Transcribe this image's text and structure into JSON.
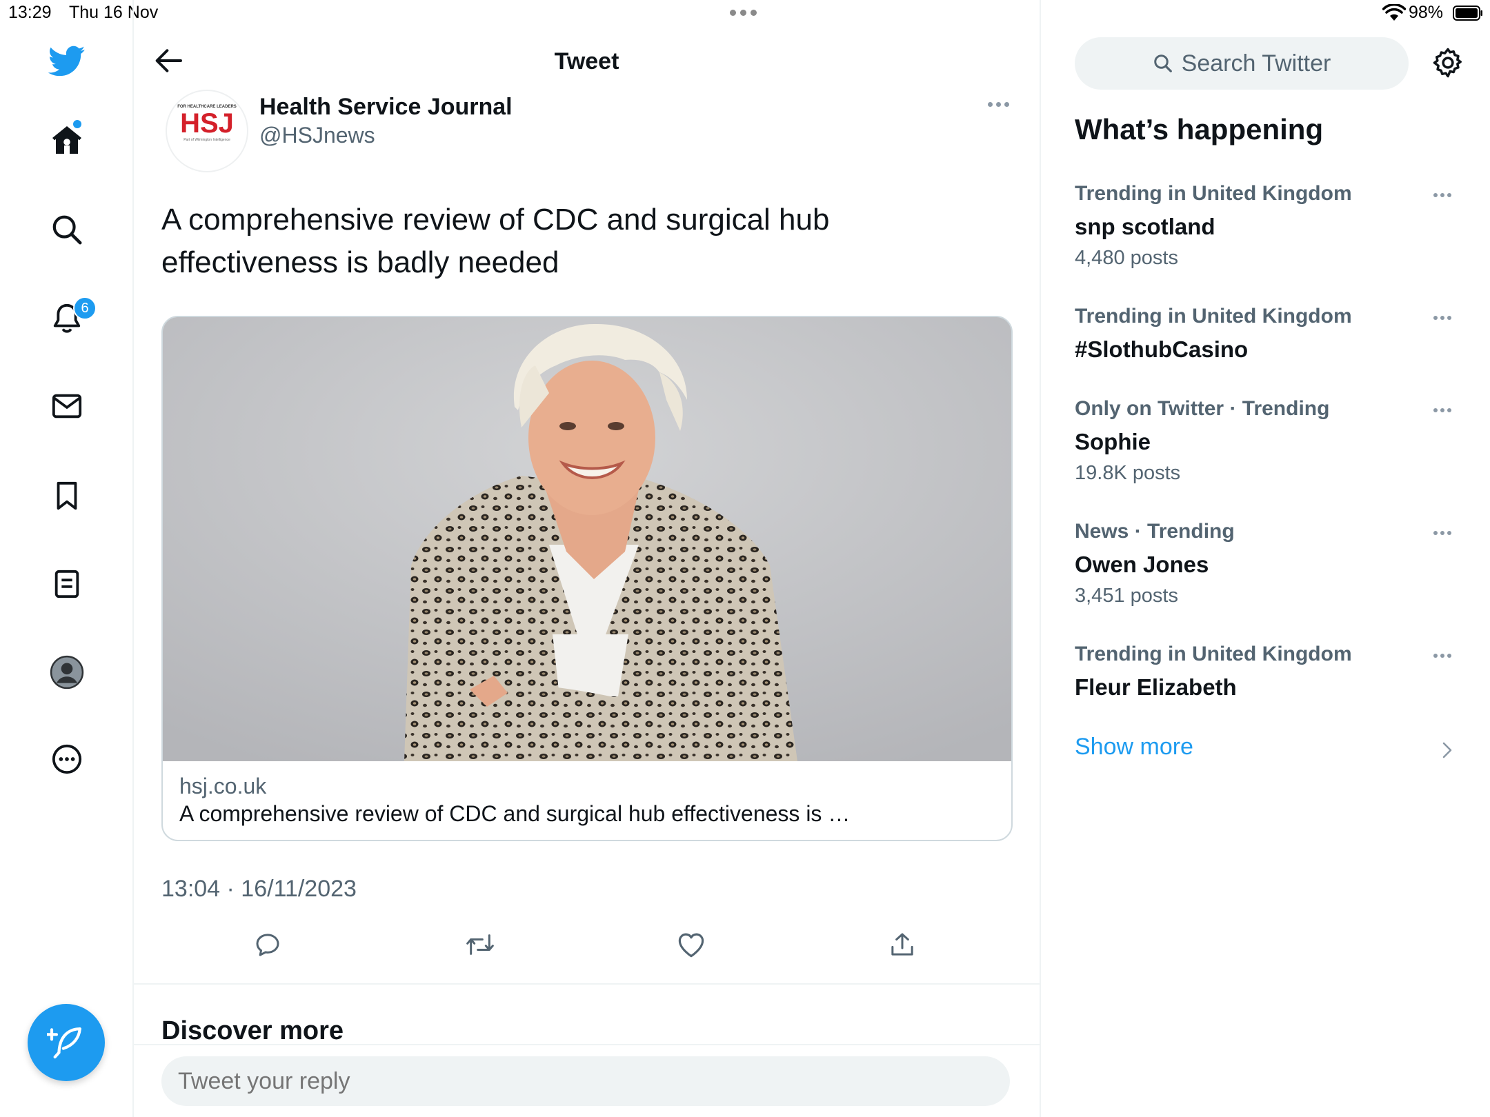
{
  "status_bar": {
    "time": "13:29",
    "date": "Thu 16 Nov",
    "battery": "98%"
  },
  "nav": {
    "items": [
      "home",
      "explore",
      "notifications",
      "messages",
      "bookmarks",
      "lists",
      "profile",
      "more"
    ],
    "notifications_count": "6"
  },
  "header": {
    "title": "Tweet"
  },
  "tweet": {
    "author_name": "Health Service Journal",
    "handle": "@HSJnews",
    "logo_text": "HSJ",
    "logo_tagline": "FOR HEALTHCARE LEADERS",
    "logo_sub": "Part of Wilmington Intelligence",
    "text": "A comprehensive review of CDC and surgical hub effectiveness is badly needed",
    "card": {
      "domain": "hsj.co.uk",
      "title": "A comprehensive review of CDC and surgical hub effectiveness is …"
    },
    "timestamp": "13:04 · 16/11/2023"
  },
  "discover": {
    "title": "Discover more"
  },
  "reply": {
    "placeholder": "Tweet your reply"
  },
  "search": {
    "placeholder": "Search Twitter"
  },
  "sidebar": {
    "title": "What’s happening",
    "trends": [
      {
        "context": "Trending in United Kingdom",
        "name": "snp scotland",
        "count": "4,480 posts"
      },
      {
        "context": "Trending in United Kingdom",
        "name": "#SlothubCasino",
        "count": ""
      },
      {
        "context": "Only on Twitter · Trending",
        "name": "Sophie",
        "count": "19.8K posts"
      },
      {
        "context": "News · Trending",
        "name": "Owen Jones",
        "count": "3,451 posts"
      },
      {
        "context": "Trending in United Kingdom",
        "name": "Fleur Elizabeth",
        "count": ""
      }
    ],
    "show_more": "Show more"
  },
  "colors": {
    "accent": "#1d9bf0",
    "text": "#0f1419",
    "secondary": "#536471",
    "logo_red": "#d4202a"
  }
}
